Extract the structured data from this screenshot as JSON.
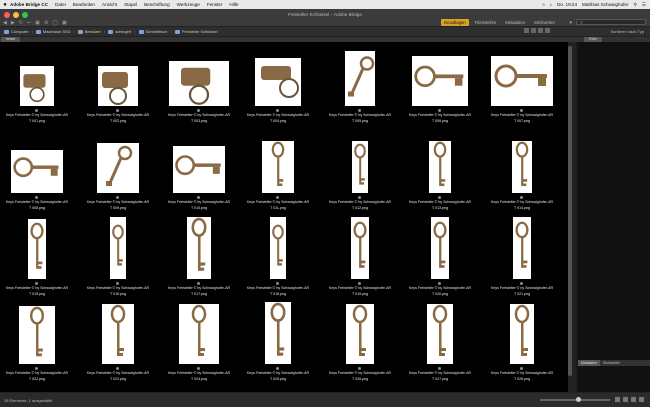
{
  "menubar": {
    "items": [
      "Adobe Bridge CC",
      "Datei",
      "Bearbeiten",
      "Ansicht",
      "Stapel",
      "Beschriftung",
      "Werkzeuge",
      "Fenster",
      "Hilfe"
    ],
    "clock": "Do. 19:24",
    "user": "Matthias Schwaighofer"
  },
  "window": {
    "title": "Freisteller Schlüssel – Adobe Bridge"
  },
  "workspaces": {
    "items": [
      "Grundlagen",
      "Filmstreifen",
      "Metadaten",
      "Stichwörter"
    ],
    "active_index": 0
  },
  "search": {
    "placeholder": ""
  },
  "path": {
    "crumbs": [
      "Computer",
      "Macintosh SSD",
      "Benutzer",
      "schinge9",
      "Schreibtisch",
      "Freisteller Schlüssel"
    ]
  },
  "sort": {
    "label": "Sortieren nach Typ"
  },
  "panels": {
    "content_tab": "Inhalt",
    "filter_tab": "Filter",
    "bottom_tabs": [
      "Metadaten",
      "Stichwörter"
    ]
  },
  "status": {
    "count": "28 Elemente, 1 ausgewählt",
    "zoom_fraction": 0.55
  },
  "colors": {
    "accent": "#d8a12a",
    "caption": "#e6e6e6"
  },
  "thumbnails": [
    {
      "line1": "Keys Freisteller © by Schwaighofer-AR",
      "line2": "T 001.png"
    },
    {
      "line1": "Keys Freisteller © by Schwaighofer-AR",
      "line2": "T 002.png"
    },
    {
      "line1": "Keys Freisteller © by Schwaighofer-AR",
      "line2": "T 003.png"
    },
    {
      "line1": "Keys Freisteller © by Schwaighofer-AR",
      "line2": "T 004.png"
    },
    {
      "line1": "Keys Freisteller © by Schwaighofer-AR",
      "line2": "T 005.png"
    },
    {
      "line1": "Keys Freisteller © by Schwaighofer-AR",
      "line2": "T 006.png"
    },
    {
      "line1": "Keys Freisteller © by Schwaighofer-AR",
      "line2": "T 007.png"
    },
    {
      "line1": "Keys Freisteller © by Schwaighofer-AR",
      "line2": "T 008.png"
    },
    {
      "line1": "Keys Freisteller © by Schwaighofer-AR",
      "line2": "T 009.png"
    },
    {
      "line1": "Keys Freisteller © by Schwaighofer-AR",
      "line2": "T 010.png"
    },
    {
      "line1": "Keys Freisteller © by Schwaighofer-AR",
      "line2": "T 011.png"
    },
    {
      "line1": "Keys Freisteller © by Schwaighofer-AR",
      "line2": "T 012.png"
    },
    {
      "line1": "Keys Freisteller © by Schwaighofer-AR",
      "line2": "T 013.png"
    },
    {
      "line1": "Keys Freisteller © by Schwaighofer-AR",
      "line2": "T 014.png"
    },
    {
      "line1": "Keys Freisteller © by Schwaighofer-AR",
      "line2": "T 015.png"
    },
    {
      "line1": "Keys Freisteller © by Schwaighofer-AR",
      "line2": "T 016.png"
    },
    {
      "line1": "Keys Freisteller © by Schwaighofer-AR",
      "line2": "T 017.png"
    },
    {
      "line1": "Keys Freisteller © by Schwaighofer-AR",
      "line2": "T 018.png"
    },
    {
      "line1": "Keys Freisteller © by Schwaighofer-AR",
      "line2": "T 019.png"
    },
    {
      "line1": "Keys Freisteller © by Schwaighofer-AR",
      "line2": "T 020.png"
    },
    {
      "line1": "Keys Freisteller © by Schwaighofer-AR",
      "line2": "T 021.png"
    },
    {
      "line1": "Keys Freisteller © by Schwaighofer-AR",
      "line2": "T 022.png"
    },
    {
      "line1": "Keys Freisteller © by Schwaighofer-AR",
      "line2": "T 023.png"
    },
    {
      "line1": "Keys Freisteller © by Schwaighofer-AR",
      "line2": "T 024.png"
    },
    {
      "line1": "Keys Freisteller © by Schwaighofer-AR",
      "line2": "T 025.png"
    },
    {
      "line1": "Keys Freisteller © by Schwaighofer-AR",
      "line2": "T 026.png"
    },
    {
      "line1": "Keys Freisteller © by Schwaighofer-AR",
      "line2": "T 027.png"
    },
    {
      "line1": "Keys Freisteller © by Schwaighofer-AR",
      "line2": "T 028.png"
    }
  ]
}
